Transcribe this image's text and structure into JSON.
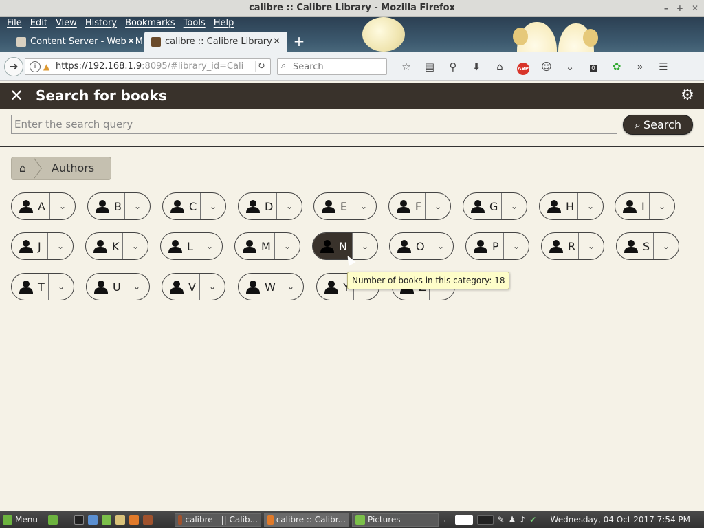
{
  "window": {
    "title": "calibre :: Calibre Library - Mozilla Firefox"
  },
  "menubar": [
    "File",
    "Edit",
    "View",
    "History",
    "Bookmarks",
    "Tools",
    "Help"
  ],
  "tabs": [
    {
      "label": "Content Server - Web - M"
    },
    {
      "label": "calibre :: Calibre Library"
    }
  ],
  "navbar": {
    "url_host": "https://192.168.1.9",
    "url_rest": ":8095/#library_id=Cali",
    "search_placeholder": "Search",
    "abp_label": "ABP",
    "badge_count": "0"
  },
  "app": {
    "title": "Search for books",
    "search_placeholder": "Enter the search query",
    "search_button": "Search"
  },
  "breadcrumb": {
    "label": "Authors"
  },
  "letters": [
    {
      "letter": "A"
    },
    {
      "letter": "B"
    },
    {
      "letter": "C"
    },
    {
      "letter": "D"
    },
    {
      "letter": "E"
    },
    {
      "letter": "F"
    },
    {
      "letter": "G"
    },
    {
      "letter": "H"
    },
    {
      "letter": "I"
    },
    {
      "letter": "J"
    },
    {
      "letter": "K"
    },
    {
      "letter": "L"
    },
    {
      "letter": "M"
    },
    {
      "letter": "N"
    },
    {
      "letter": "O"
    },
    {
      "letter": "P"
    },
    {
      "letter": "R"
    },
    {
      "letter": "S"
    },
    {
      "letter": "T"
    },
    {
      "letter": "U"
    },
    {
      "letter": "V"
    },
    {
      "letter": "W"
    },
    {
      "letter": "Y"
    },
    {
      "letter": "Z"
    }
  ],
  "hovered_letter": "N",
  "tooltip": "Number of books in this category: 18",
  "taskbar": {
    "menu_label": "Menu",
    "windows": [
      {
        "label": "calibre - || Calib..."
      },
      {
        "label": "calibre :: Calibr..."
      },
      {
        "label": "Pictures"
      }
    ],
    "clock": "Wednesday, 04 Oct 2017  7:54 PM"
  }
}
